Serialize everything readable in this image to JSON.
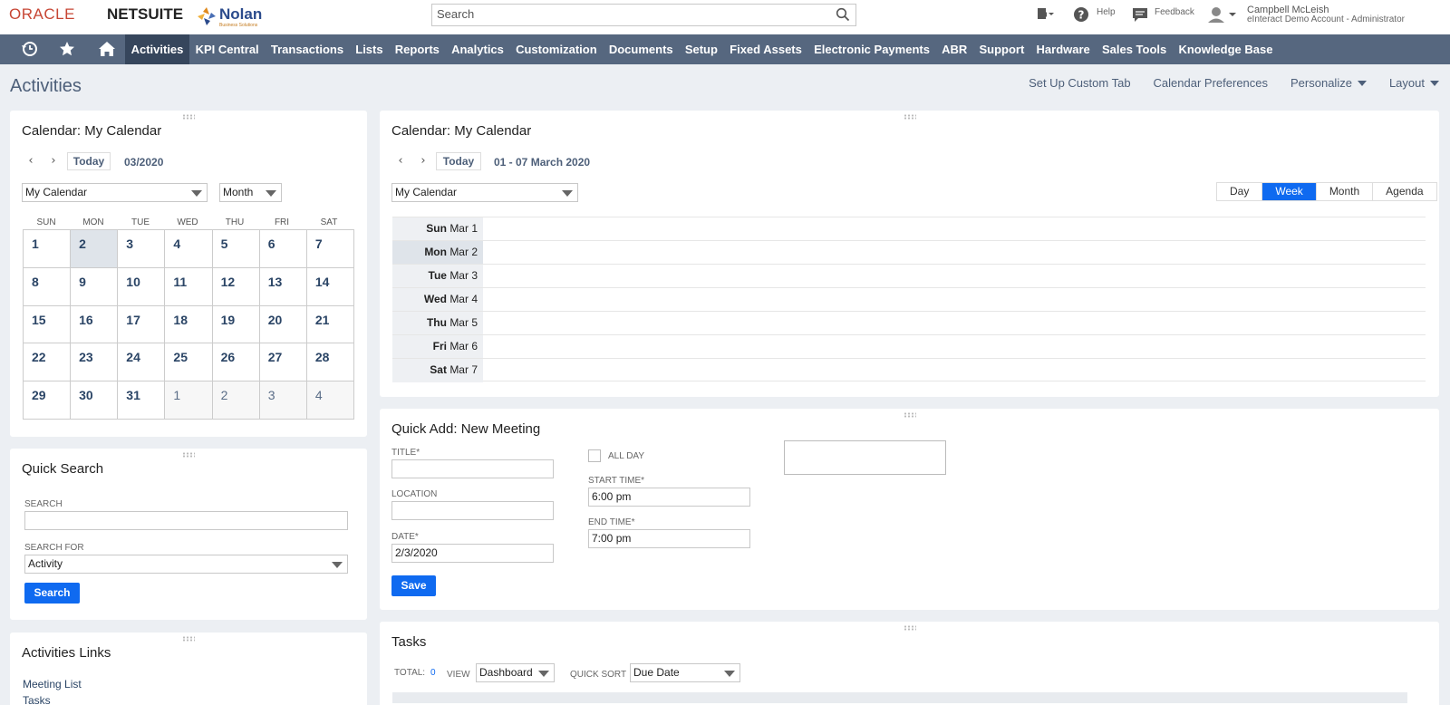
{
  "header": {
    "logo_oracle": "ORACLE",
    "logo_netsuite": "NETSUITE",
    "logo_nolan": "Nolan",
    "logo_nolan_sub": "Business Solutions",
    "search_placeholder": "Search",
    "help_label": "Help",
    "feedback_label": "Feedback",
    "user_name": "Campbell McLeish",
    "user_role": "eInteract Demo Account - Administrator"
  },
  "nav": {
    "icons": [
      "recent-icon",
      "star-icon",
      "home-icon"
    ],
    "items": [
      "Activities",
      "KPI Central",
      "Transactions",
      "Lists",
      "Reports",
      "Analytics",
      "Customization",
      "Documents",
      "Setup",
      "Fixed Assets",
      "Electronic Payments",
      "ABR",
      "Support",
      "Hardware",
      "Sales Tools",
      "Knowledge Base"
    ],
    "active": "Activities"
  },
  "page": {
    "title": "Activities",
    "actions": {
      "custom_tab": "Set Up Custom Tab",
      "cal_prefs": "Calendar Preferences",
      "personalize": "Personalize",
      "layout": "Layout"
    }
  },
  "mini_calendar": {
    "title": "Calendar: My Calendar",
    "today_label": "Today",
    "period": "03/2020",
    "calendar_select": "My Calendar",
    "view_select": "Month",
    "dow": [
      "SUN",
      "MON",
      "TUE",
      "WED",
      "THU",
      "FRI",
      "SAT"
    ],
    "days": [
      "1",
      "2",
      "3",
      "4",
      "5",
      "6",
      "7",
      "8",
      "9",
      "10",
      "11",
      "12",
      "13",
      "14",
      "15",
      "16",
      "17",
      "18",
      "19",
      "20",
      "21",
      "22",
      "23",
      "24",
      "25",
      "26",
      "27",
      "28",
      "29",
      "30",
      "31",
      "1",
      "2",
      "3",
      "4"
    ]
  },
  "week_calendar": {
    "title": "Calendar: My Calendar",
    "today_label": "Today",
    "period": "01 - 07 March 2020",
    "calendar_select": "My Calendar",
    "views": [
      "Day",
      "Week",
      "Month",
      "Agenda"
    ],
    "active_view": "Week",
    "rows": [
      {
        "dow": "Sun",
        "date": "Mar 1"
      },
      {
        "dow": "Mon",
        "date": "Mar 2"
      },
      {
        "dow": "Tue",
        "date": "Mar 3"
      },
      {
        "dow": "Wed",
        "date": "Mar 4"
      },
      {
        "dow": "Thu",
        "date": "Mar 5"
      },
      {
        "dow": "Fri",
        "date": "Mar 6"
      },
      {
        "dow": "Sat",
        "date": "Mar 7"
      }
    ]
  },
  "quick_search": {
    "title": "Quick Search",
    "search_label": "SEARCH",
    "search_value": "",
    "search_for_label": "SEARCH FOR",
    "search_for_value": "Activity",
    "button": "Search"
  },
  "quick_add": {
    "title": "Quick Add: New Meeting",
    "title_label": "TITLE*",
    "title_value": "",
    "location_label": "LOCATION",
    "location_value": "",
    "date_label": "DATE*",
    "date_value": "2/3/2020",
    "all_day_label": "ALL DAY",
    "start_label": "START TIME*",
    "start_value": "6:00 pm",
    "end_label": "END TIME*",
    "end_value": "7:00 pm",
    "save": "Save"
  },
  "activities_links": {
    "title": "Activities Links",
    "links": [
      "Meeting List",
      "Tasks"
    ]
  },
  "tasks": {
    "title": "Tasks",
    "total_label": "TOTAL:",
    "total_value": "0",
    "view_label": "VIEW",
    "view_value": "Dashboard",
    "sort_label": "QUICK SORT",
    "sort_value": "Due Date"
  },
  "colors": {
    "nav_bg": "#56677f",
    "nav_active": "#36465c",
    "accent_blue": "#0f6af0",
    "oracle_red": "#c74634"
  }
}
